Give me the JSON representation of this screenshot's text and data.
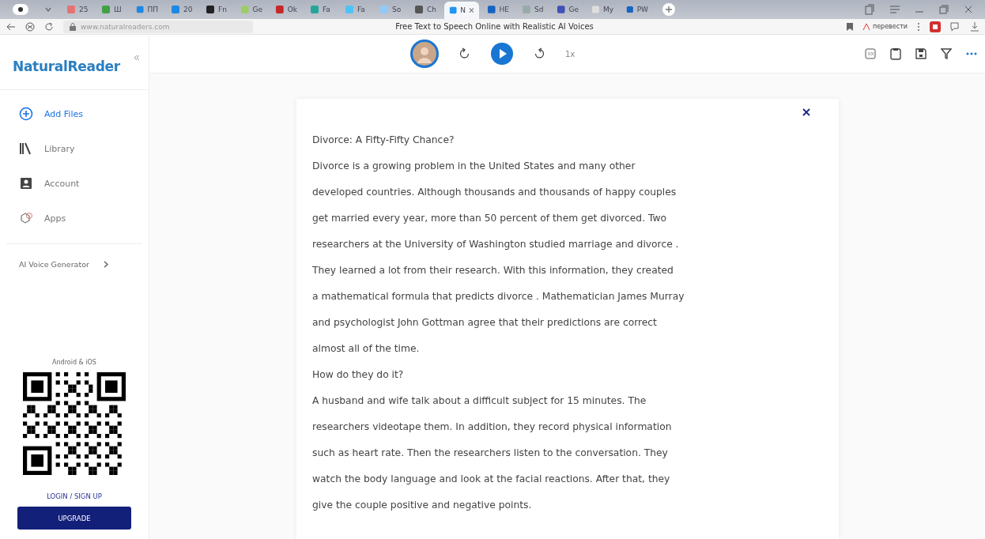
{
  "browser": {
    "tabs": [
      {
        "label": "25",
        "selected": false
      },
      {
        "label": "Ш",
        "selected": false
      },
      {
        "label": "ПП",
        "selected": false
      },
      {
        "label": "20",
        "selected": false
      },
      {
        "label": "Fn",
        "selected": false
      },
      {
        "label": "Ge",
        "selected": false
      },
      {
        "label": "Ok",
        "selected": false
      },
      {
        "label": "Fa",
        "selected": false
      },
      {
        "label": "Fa",
        "selected": false
      },
      {
        "label": "So",
        "selected": false
      },
      {
        "label": "Ch",
        "selected": false
      },
      {
        "label": "N",
        "selected": true
      },
      {
        "label": "НЕ",
        "selected": false
      },
      {
        "label": "Sd",
        "selected": false
      },
      {
        "label": "Ge",
        "selected": false
      },
      {
        "label": "My",
        "selected": false
      },
      {
        "label": "PW",
        "selected": false
      }
    ],
    "address": "www.naturalreaders.com",
    "page_title": "Free Text to Speech Online with Realistic AI Voices",
    "translate_label": "перевести"
  },
  "sidebar": {
    "logo": "NaturalReader",
    "items": [
      {
        "kind": "add",
        "label": "Add Files",
        "selected": true
      },
      {
        "kind": "library",
        "label": "Library",
        "selected": false
      },
      {
        "kind": "account",
        "label": "Account",
        "selected": false
      },
      {
        "kind": "apps",
        "label": "Apps",
        "selected": false
      }
    ],
    "voice_generator": "AI Voice Generator",
    "qr_caption": "Android & iOS",
    "login": "LOGIN / SIGN UP",
    "upgrade": "UPGRADE"
  },
  "player": {
    "speed": "1x"
  },
  "document": {
    "lines": [
      "Divorce: A Fifty-Fifty Chance?",
      "Divorce is a growing problem in the United States and many other",
      "developed countries. Although thousands and thousands of happy couples",
      "get married every year, more than 50 percent of them get divorced. Two",
      "researchers at the University of Washington studied marriage and divorce .",
      "They learned a lot from their research. With this information, they created",
      "a mathematical formula that predicts divorce . Mathematician James Murray",
      "and psychologist John Gottman agree that their predictions are correct",
      "almost all of the time.",
      "How do they do it?",
      "A husband and wife talk about a difficult subject for 15 minutes. The",
      "researchers videotape them. In addition, they record physical information",
      "such as heart rate. Then the researchers listen to the conversation. They",
      "watch the body language and look at the facial reactions. After that, they",
      "give the couple positive and negative points."
    ]
  }
}
